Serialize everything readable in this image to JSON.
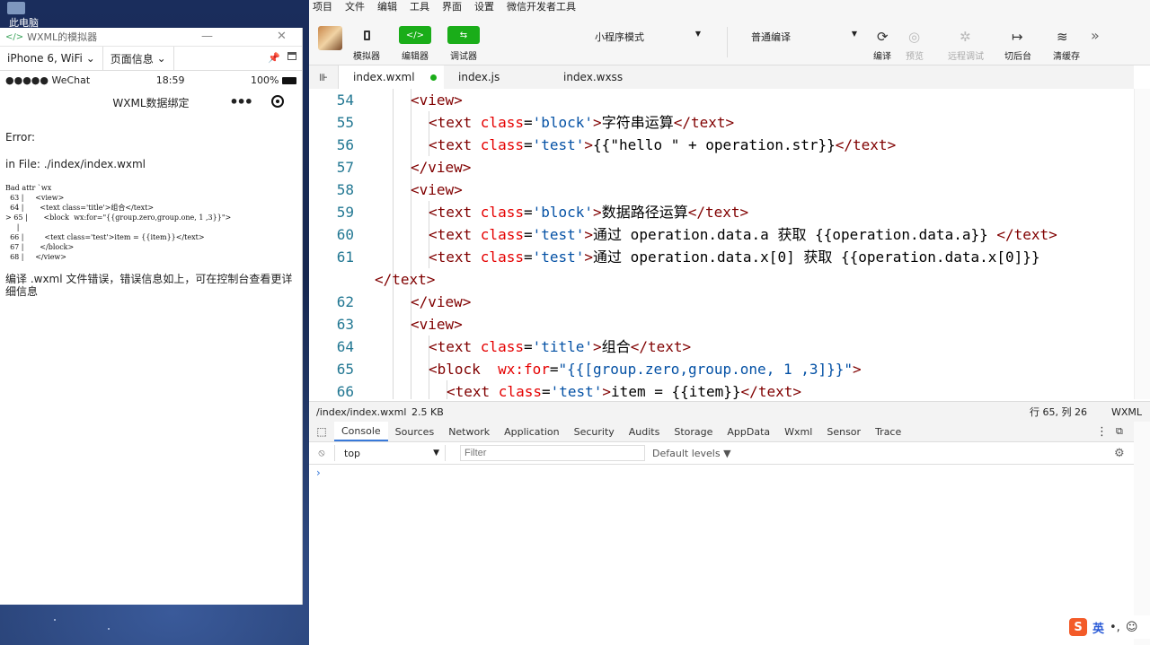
{
  "desktop": {
    "icon_label": "此电脑"
  },
  "simulator": {
    "title": "WXML的模拟器",
    "device": "iPhone 6, WiFi",
    "device_arrow": "⌄",
    "page_info": "页面信息",
    "status": {
      "carrier": "●●●●● WeChat",
      "time": "18:59",
      "battery": "100%"
    },
    "nav_title": "WXML数据绑定",
    "error_label": "Error:",
    "error_file": "in File: ./index/index.wxml",
    "error_detail": "Bad attr `wx\n  63 |     <view>\n  64 |       <text class='title'>组合</text>\n> 65 |       <block  wx:for=\"{{group.zero,group.one, 1 ,3}}\">\n     |\n  66 |         <text class='test'>item = {{item}}</text>\n  67 |       </block>\n  68 |     </view>",
    "error_desc": "编译 .wxml 文件错误，错误信息如上，可在控制台查看更详细信息"
  },
  "menu": [
    "项目",
    "文件",
    "编辑",
    "工具",
    "界面",
    "设置",
    "微信开发者工具"
  ],
  "toolbar": {
    "simulator": "模拟器",
    "editor": "编辑器",
    "debugger": "调试器",
    "mode": "小程序模式",
    "compile_mode": "普通编译",
    "compile": "编译",
    "preview": "预览",
    "remote_debug": "远程调试",
    "background": "切后台",
    "clear_cache": "清缓存"
  },
  "tabs": [
    "index.wxml",
    "index.js",
    "index.wxss"
  ],
  "code_lines": [
    {
      "n": "54",
      "indent": 2,
      "parts": [
        [
          "tag",
          "<view>"
        ]
      ]
    },
    {
      "n": "55",
      "indent": 3,
      "parts": [
        [
          "tag",
          "<text "
        ],
        [
          "at",
          "class"
        ],
        [
          "tx",
          "="
        ],
        [
          "sv",
          "'block'"
        ],
        [
          "tag",
          ">"
        ],
        [
          "tx",
          "字符串运算"
        ],
        [
          "tag",
          "</text>"
        ]
      ]
    },
    {
      "n": "56",
      "indent": 3,
      "parts": [
        [
          "tag",
          "<text "
        ],
        [
          "at",
          "class"
        ],
        [
          "tx",
          "="
        ],
        [
          "sv",
          "'test'"
        ],
        [
          "tag",
          ">"
        ],
        [
          "tx",
          "{{\"hello \" + operation.str}}"
        ],
        [
          "tag",
          "</text>"
        ]
      ]
    },
    {
      "n": "57",
      "indent": 2,
      "parts": [
        [
          "tag",
          "</view>"
        ]
      ]
    },
    {
      "n": "58",
      "indent": 2,
      "parts": [
        [
          "tag",
          "<view>"
        ]
      ]
    },
    {
      "n": "59",
      "indent": 3,
      "parts": [
        [
          "tag",
          "<text "
        ],
        [
          "at",
          "class"
        ],
        [
          "tx",
          "="
        ],
        [
          "sv",
          "'block'"
        ],
        [
          "tag",
          ">"
        ],
        [
          "tx",
          "数据路径运算"
        ],
        [
          "tag",
          "</text>"
        ]
      ]
    },
    {
      "n": "60",
      "indent": 3,
      "parts": [
        [
          "tag",
          "<text "
        ],
        [
          "at",
          "class"
        ],
        [
          "tx",
          "="
        ],
        [
          "sv",
          "'test'"
        ],
        [
          "tag",
          ">"
        ],
        [
          "tx",
          "通过 operation.data.a 获取 {{operation.data.a}} "
        ],
        [
          "tag",
          "</text>"
        ]
      ]
    },
    {
      "n": "61",
      "indent": 3,
      "parts": [
        [
          "tag",
          "<text "
        ],
        [
          "at",
          "class"
        ],
        [
          "tx",
          "="
        ],
        [
          "sv",
          "'test'"
        ],
        [
          "tag",
          ">"
        ],
        [
          "tx",
          "通过 operation.data.x[0] 获取 {{operation.data.x[0]}}"
        ]
      ]
    },
    {
      "n": "",
      "indent": 0,
      "parts": [
        [
          "tag",
          "</text>"
        ]
      ]
    },
    {
      "n": "62",
      "indent": 2,
      "parts": [
        [
          "tag",
          "</view>"
        ]
      ]
    },
    {
      "n": "63",
      "indent": 2,
      "parts": [
        [
          "tag",
          "<view>"
        ]
      ]
    },
    {
      "n": "64",
      "indent": 3,
      "parts": [
        [
          "tag",
          "<text "
        ],
        [
          "at",
          "class"
        ],
        [
          "tx",
          "="
        ],
        [
          "sv",
          "'title'"
        ],
        [
          "tag",
          ">"
        ],
        [
          "tx",
          "组合"
        ],
        [
          "tag",
          "</text>"
        ]
      ]
    },
    {
      "n": "65",
      "indent": 3,
      "parts": [
        [
          "tag",
          "<block  "
        ],
        [
          "at",
          "wx:for"
        ],
        [
          "tx",
          "="
        ],
        [
          "sv",
          "\"{{[group.zero,group.one, 1 ,3]}}\""
        ],
        [
          "tag",
          ">"
        ]
      ]
    },
    {
      "n": "66",
      "indent": 4,
      "parts": [
        [
          "tag",
          "<text "
        ],
        [
          "at",
          "class"
        ],
        [
          "tx",
          "="
        ],
        [
          "sv",
          "'test'"
        ],
        [
          "tag",
          ">"
        ],
        [
          "tx",
          "item = {{item}}"
        ],
        [
          "tag",
          "</text>"
        ]
      ]
    }
  ],
  "statusbar": {
    "path": "/index/index.wxml",
    "size": "2.5 KB",
    "position": "行 65, 列 26",
    "lang": "WXML"
  },
  "devtools": {
    "tabs": [
      "Console",
      "Sources",
      "Network",
      "Application",
      "Security",
      "Audits",
      "Storage",
      "AppData",
      "Wxml",
      "Sensor",
      "Trace"
    ],
    "context": "top",
    "filter_placeholder": "Filter",
    "levels": "Default levels ▼",
    "prompt": "›"
  },
  "tray": {
    "ime": "英"
  }
}
